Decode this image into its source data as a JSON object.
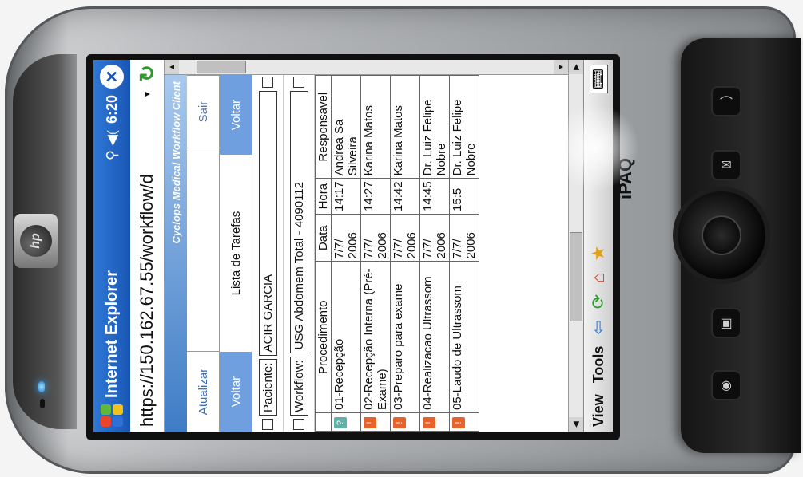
{
  "device": {
    "brand": "hp",
    "model": "iPAQ"
  },
  "title_bar": {
    "app_title": "Internet Explorer",
    "clock": "6:20",
    "close": "✕",
    "signal_icons": "⚲ ◀⦅"
  },
  "address_bar": {
    "url": "https://150.162.67.55/workflow/d",
    "dropdown": "▾",
    "go": "↻"
  },
  "banner": {
    "text": "Cyclops Medical Workflow Client"
  },
  "actions": {
    "refresh": "Atualizar",
    "exit": "Sair"
  },
  "nav": {
    "back_left": "Voltar",
    "list_title": "Lista de Tarefas",
    "back_right": "Voltar"
  },
  "fields": {
    "patient": {
      "label": "Paciente:",
      "value": "ACIR GARCIA"
    },
    "workflow": {
      "label": "Workflow:",
      "value": "USG Abdomem Total - 4090112"
    }
  },
  "table": {
    "headers": [
      "Procedimento",
      "Data",
      "Hora",
      "Responsavel"
    ],
    "rows": [
      {
        "status": "?",
        "status_color": "#5fb0a8",
        "procedure": "01-Recepção",
        "date": "7/7/ 2006",
        "time": "14:17",
        "responsible": "Andrea Sa Silveira"
      },
      {
        "status": "!",
        "status_color": "#e8622c",
        "procedure": "02-Recepção Interna (Pré-Exame)",
        "date": "7/7/ 2006",
        "time": "14:27",
        "responsible": "Karina Matos"
      },
      {
        "status": "!",
        "status_color": "#e8622c",
        "procedure": "03-Preparo para exame",
        "date": "7/7/ 2006",
        "time": "14:42",
        "responsible": "Karina Matos"
      },
      {
        "status": "!",
        "status_color": "#e8622c",
        "procedure": "04-Realizacao Ultrassom",
        "date": "7/7/ 2006",
        "time": "14:45",
        "responsible": "Dr. Luiz Felipe Nobre"
      },
      {
        "status": "!",
        "status_color": "#e8622c",
        "procedure": "05-Laudo de Ultrassom",
        "date": "7/7/ 2006",
        "time": "15:5",
        "responsible": "Dr. Luiz Felipe Nobre"
      }
    ]
  },
  "menu_bar": {
    "view": "View",
    "tools": "Tools",
    "back_icon": "⇦",
    "refresh_icon": "⟳",
    "home_icon": "⌂",
    "favorites_icon": "★",
    "keyboard": "⌨"
  },
  "colors": {
    "title_bar": "#1a56b4",
    "button_blue": "#6f9fdf",
    "status_orange": "#e8622c",
    "status_teal": "#5fb0a8"
  }
}
